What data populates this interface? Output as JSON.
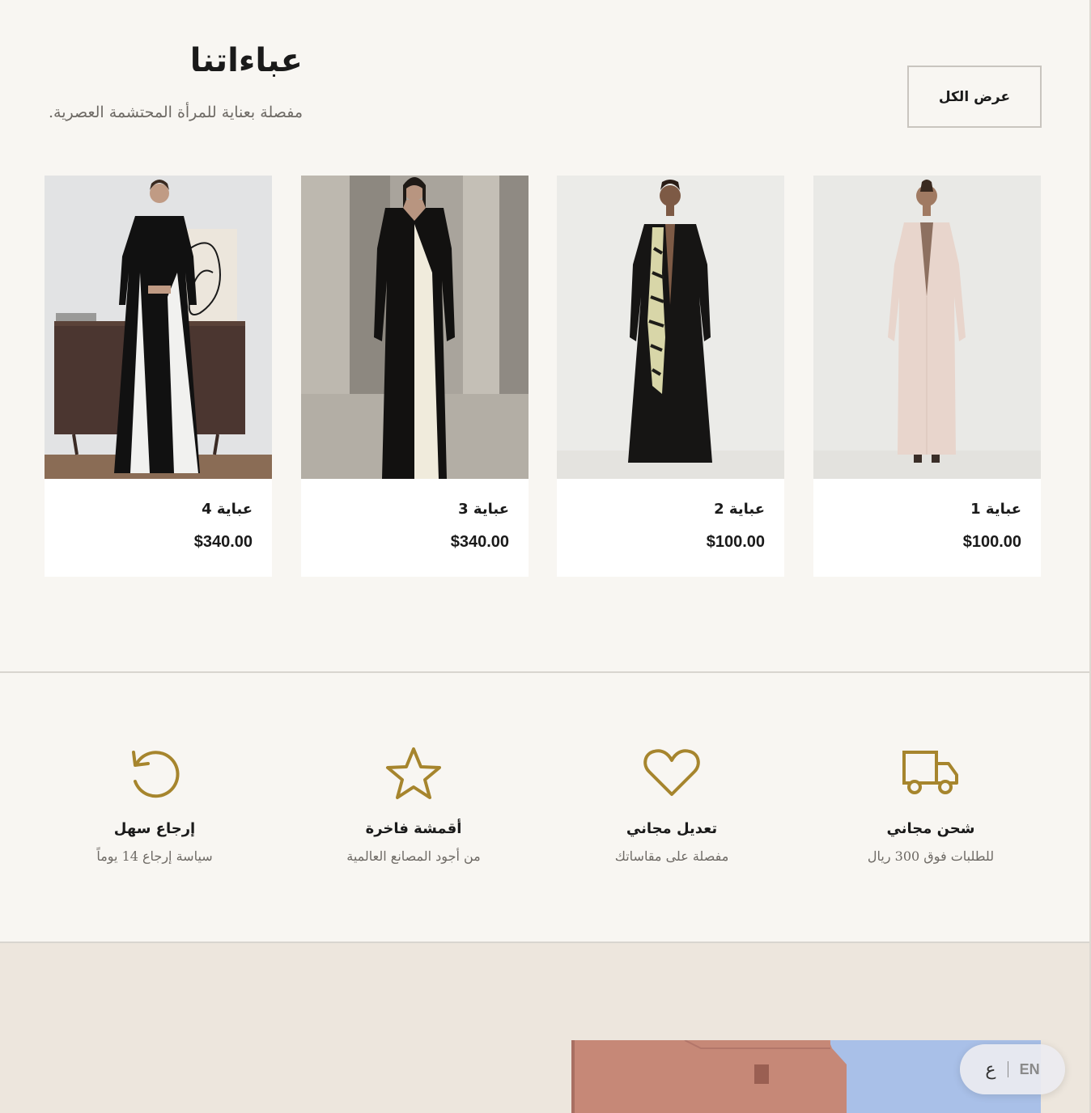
{
  "header": {
    "title": "عباءاتنا",
    "subtitle": "مفصلة بعناية للمرأة المحتشمة العصرية.",
    "view_all_label": "عرض الكل"
  },
  "products": [
    {
      "name": "عباية 1",
      "price": "$100.00"
    },
    {
      "name": "عباية 2",
      "price": "$100.00"
    },
    {
      "name": "عباية 3",
      "price": "$340.00"
    },
    {
      "name": "عباية 4",
      "price": "$340.00"
    }
  ],
  "features": [
    {
      "icon": "truck-icon",
      "title": "شحن مجاني",
      "desc": "للطلبات فوق 300 ريال"
    },
    {
      "icon": "heart-icon",
      "title": "تعديل مجاني",
      "desc": "مفصلة على مقاساتك"
    },
    {
      "icon": "star-icon",
      "title": "أقمشة فاخرة",
      "desc": "من أجود المصانع العالمية"
    },
    {
      "icon": "return-icon",
      "title": "إرجاع سهل",
      "desc": "سياسة إرجاع 14 يوماً"
    }
  ],
  "language_switcher": {
    "arabic": "ع",
    "english": "EN"
  },
  "colors": {
    "accent": "#a6852d",
    "background": "#f8f6f2",
    "band": "#ede6dd"
  }
}
